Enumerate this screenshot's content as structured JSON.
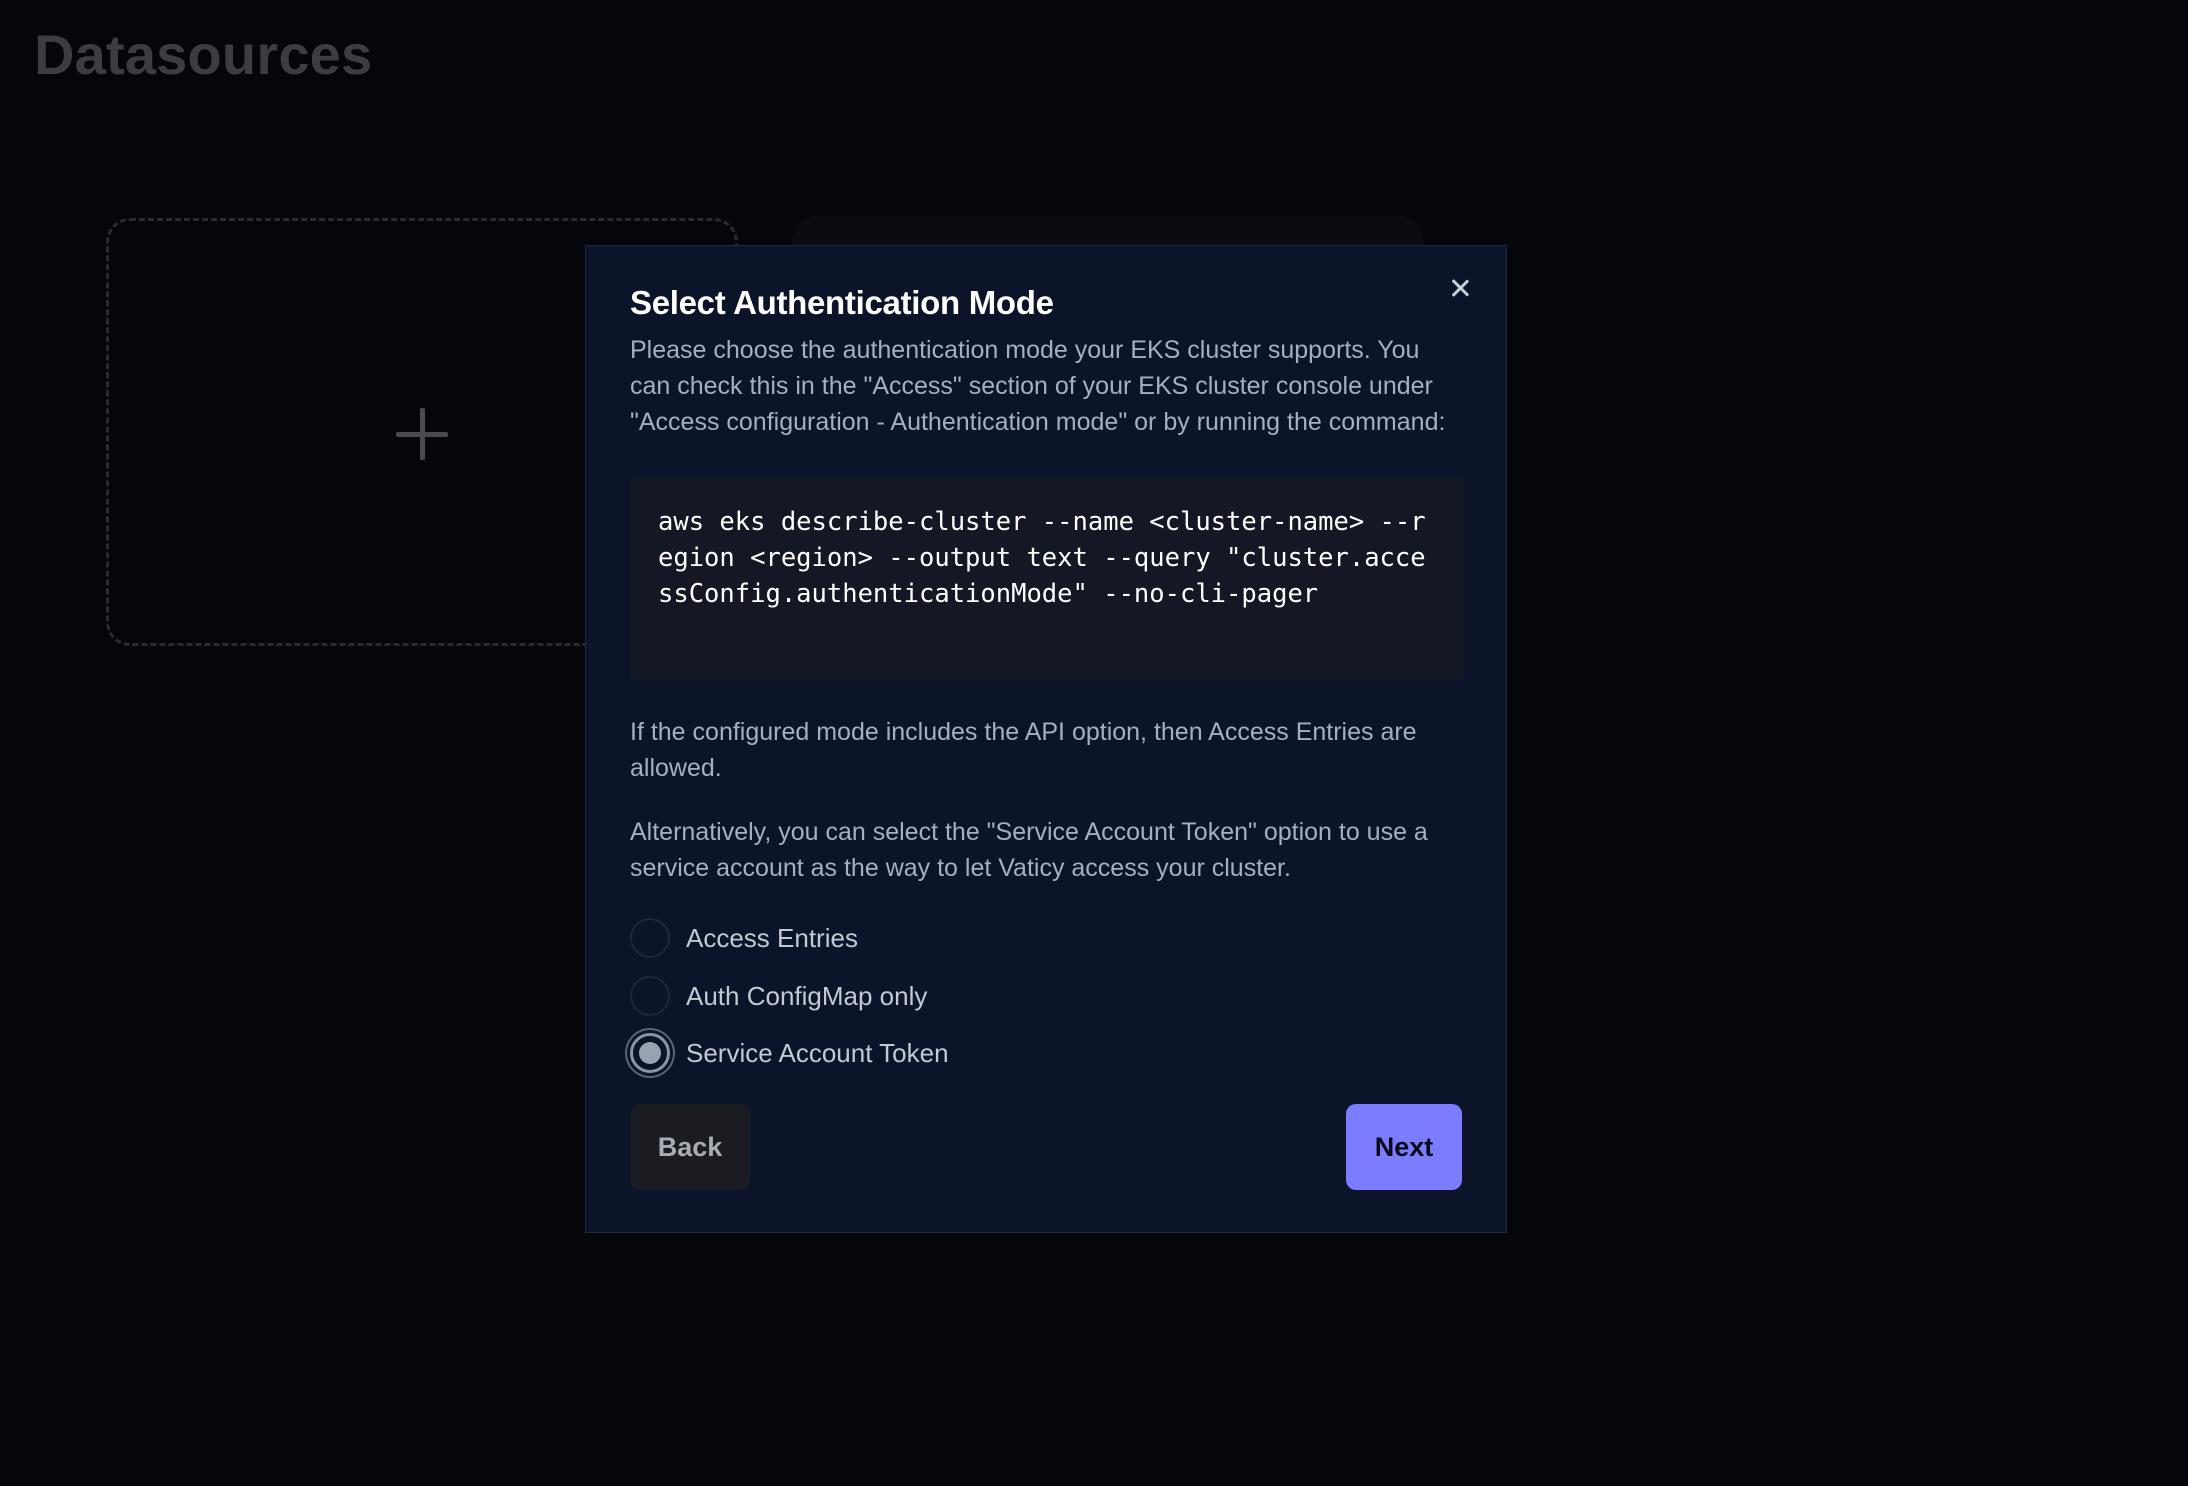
{
  "page": {
    "title": "Datasources"
  },
  "modal": {
    "title": "Select Authentication Mode",
    "intro": "Please choose the authentication mode your EKS cluster supports. You can check this in the \"Access\" section of your EKS cluster console under \"Access configuration - Authentication mode\" or by running the command:",
    "command": "aws eks describe-cluster --name <cluster-name> --region <region> --output text --query \"cluster.accessConfig.authenticationMode\" --no-cli-pager",
    "api_note": "If the configured mode includes the API option, then Access Entries are allowed.",
    "alternative_note": "Alternatively, you can select the \"Service Account Token\" option to use a service account as the way to let Vaticy access your cluster.",
    "options": [
      {
        "label": "Access Entries",
        "selected": false
      },
      {
        "label": "Auth ConfigMap only",
        "selected": false
      },
      {
        "label": "Service Account Token",
        "selected": true
      }
    ],
    "back_label": "Back",
    "next_label": "Next"
  },
  "icons": {
    "close": "close-icon",
    "add": "plus-icon"
  },
  "colors": {
    "modal_bg": "#0b1429",
    "primary_button": "#7b7cff",
    "code_bg": "#131824",
    "page_bg": "#05060b"
  }
}
